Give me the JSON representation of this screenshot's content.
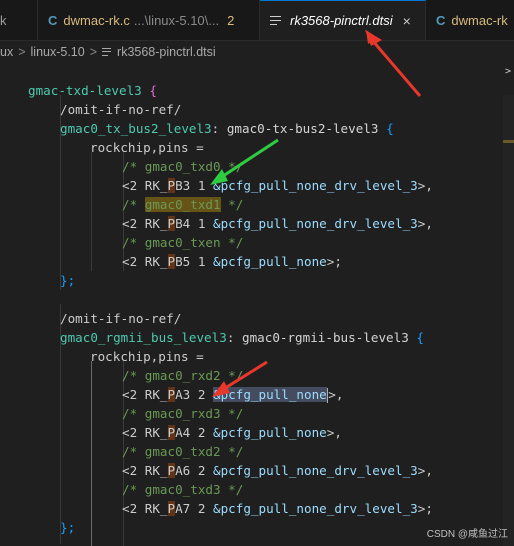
{
  "tabs": [
    {
      "icon": "",
      "label": "k",
      "dirty": ""
    },
    {
      "icon": "C",
      "label": "dwmac-rk.c",
      "path": "...\\linux-5.10\\...",
      "modified": "2"
    },
    {
      "icon": "lines-icon",
      "label": "rk3568-pinctrl.dtsi",
      "close": "×"
    },
    {
      "icon": "C",
      "label": "dwmac-rk"
    }
  ],
  "breadcrumb": {
    "items": [
      "ux",
      "linux-5.10",
      "rk3568-pinctrl.dtsi"
    ],
    "separator": ">"
  },
  "scroll_glyph": ">",
  "code": {
    "l1_name": "gmac-txd-level3",
    "l2": "/omit-if-no-ref/",
    "l3_label": "gmac0_tx_bus2_level3",
    "l3_node": "gmac0-tx-bus2-level3",
    "l4": "rockchip,pins =",
    "l5": "/* gmac0_txd0 */",
    "l6_pre": "<2 RK_",
    "l6_p": "P",
    "l6_post": "B3 1 ",
    "l6_ref": "&pcfg_pull_none_drv_level_3",
    "l6_end": ">,",
    "l7_pre": "/* ",
    "l7_word": "gmac0_txd1",
    "l7_post": " */",
    "l8_pre": "<2 RK_",
    "l8_p": "P",
    "l8_post": "B4 1 ",
    "l8_ref": "&pcfg_pull_none_drv_level_3",
    "l8_end": ">,",
    "l9": "/* gmac0_txen */",
    "l10_pre": "<2 RK_",
    "l10_p": "P",
    "l10_post": "B5 1 ",
    "l10_ref": "&pcfg_pull_none",
    "l10_end": ">;",
    "l11": "};",
    "l13": "/omit-if-no-ref/",
    "l14_label": "gmac0_rgmii_bus_level3",
    "l14_node": "gmac0-rgmii-bus-level3",
    "l15": "rockchip,pins =",
    "l16": "/* gmac0_rxd2 */",
    "l17_pre": "<2 RK_",
    "l17_p": "P",
    "l17_post": "A3 2 ",
    "l17_ref_a": "&pcfg_pull_non",
    "l17_ref_b": "e",
    "l17_end": ">,",
    "l18": "/* gmac0_rxd3 */",
    "l19_pre": "<2 RK_",
    "l19_p": "P",
    "l19_post": "A4 2 ",
    "l19_ref": "&pcfg_pull_none",
    "l19_end": ">,",
    "l20": "/* gmac0_txd2 */",
    "l21_pre": "<2 RK_",
    "l21_p": "P",
    "l21_post": "A6 2 ",
    "l21_ref": "&pcfg_pull_none_drv_level_3",
    "l21_end": ">,",
    "l22": "/* gmac0_txd3 */",
    "l23_pre": "<2 RK_",
    "l23_p": "P",
    "l23_post": "A7 2 ",
    "l23_ref": "&pcfg_pull_none_drv_level_3",
    "l23_end": ">;",
    "l24": "};"
  },
  "watermark": "CSDN @咸鱼过江",
  "colors": {
    "annotation_arrow": "#e8382c",
    "green_arrow": "#2ecc40"
  }
}
